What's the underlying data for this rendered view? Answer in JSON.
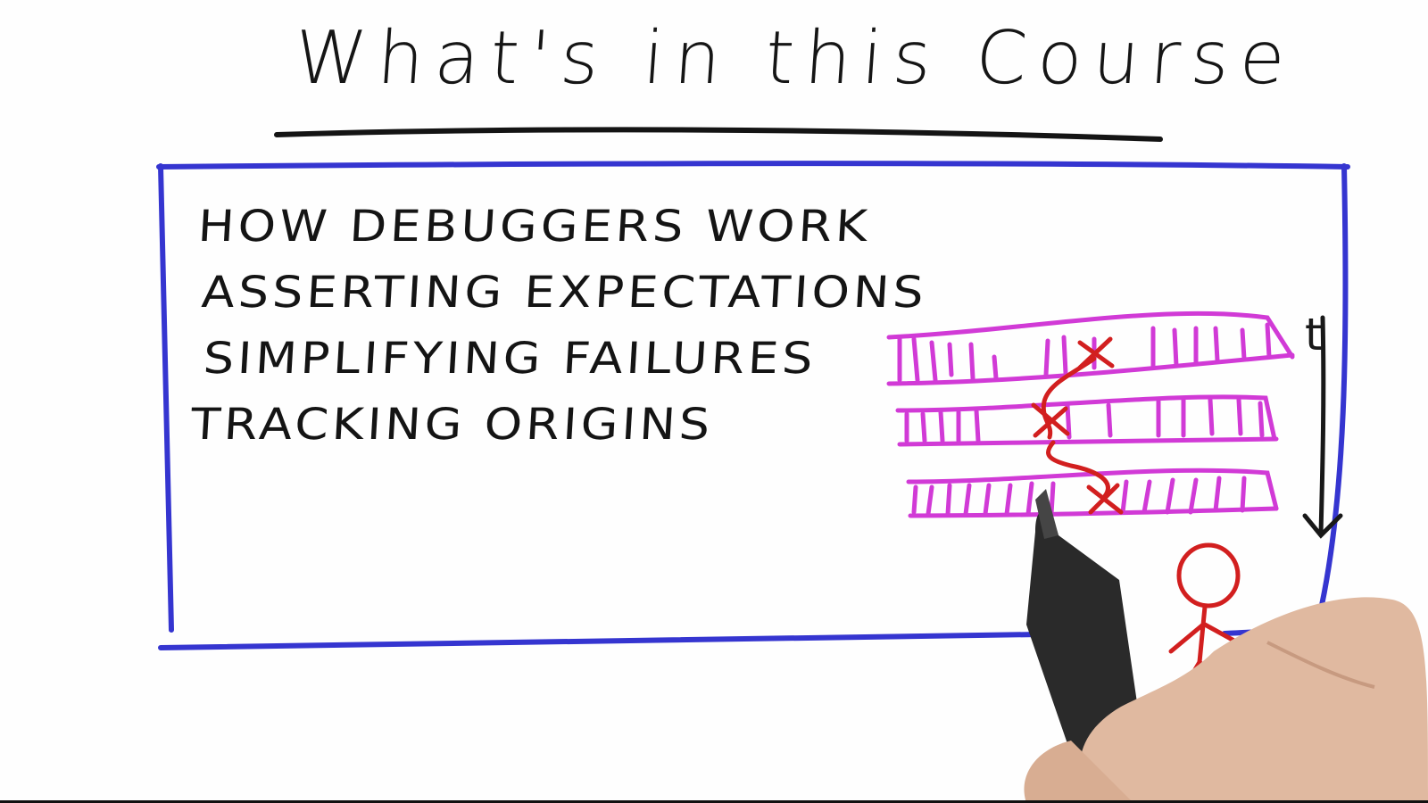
{
  "slide": {
    "title": "What's in this Course",
    "topics": [
      "HOW DEBUGGERS WORK",
      "ASSERTING EXPECTATIONS",
      "SIMPLIFYING FAILURES",
      "TRACKING ORIGINS"
    ],
    "time_axis_label": "t"
  },
  "colors": {
    "ink": "#141414",
    "box": "#3535d0",
    "tape": "#d13ad6",
    "trace": "#d21f1f",
    "hand": "#e0b9a0",
    "marker": "#2a2a2a"
  },
  "icons": [
    "execution-trace-diagram",
    "stick-figure-icon",
    "time-arrow-icon",
    "marker-pen",
    "presenter-hand"
  ]
}
